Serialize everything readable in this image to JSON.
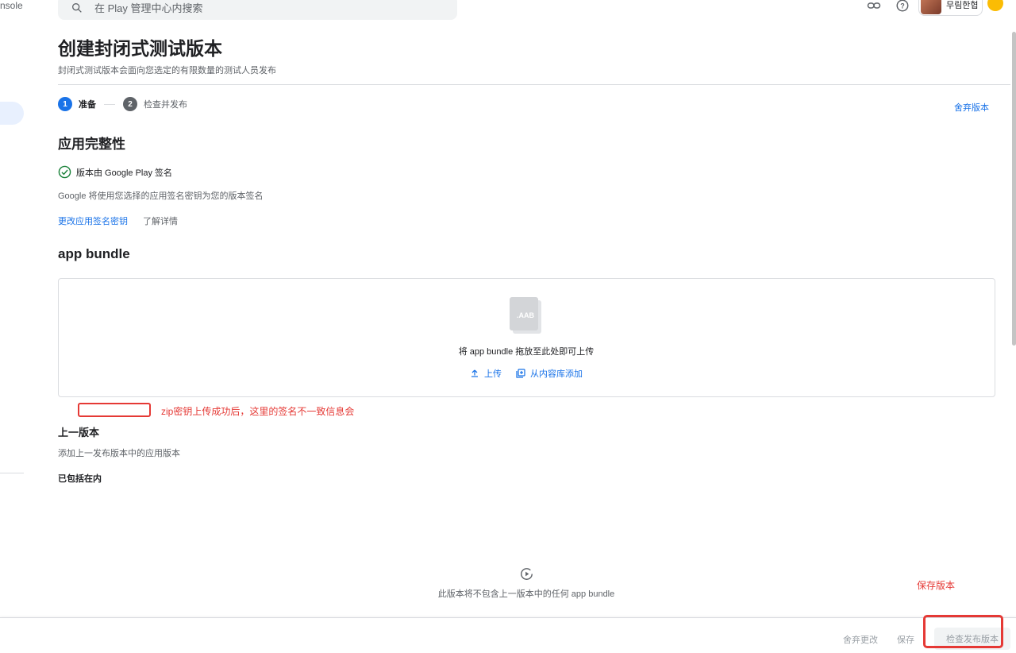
{
  "nav": {
    "console_fragment": "nsole"
  },
  "search": {
    "placeholder": "在 Play 管理中心内搜索"
  },
  "user": {
    "name": "무림한협"
  },
  "page": {
    "title": "创建封闭式测试版本",
    "subtitle": "封闭式测试版本会面向您选定的有限数量的测试人员发布"
  },
  "stepper": {
    "steps": [
      {
        "num": "1",
        "label": "准备"
      },
      {
        "num": "2",
        "label": "检查并发布"
      }
    ],
    "discard": "舍弃版本"
  },
  "integrity": {
    "title": "应用完整性",
    "status": "版本由 Google Play 签名",
    "desc": "Google 将使用您选择的应用签名密钥为您的版本签名",
    "change_link": "更改应用签名密钥",
    "learn_link": "了解详情"
  },
  "bundle": {
    "title": "app bundle",
    "file_badge": ".AAB",
    "drop_text": "将 app bundle 拖放至此处即可上传",
    "upload": "上传",
    "add_library": "从内容库添加"
  },
  "previous": {
    "title": "上一版本",
    "desc": "添加上一发布版本中的应用版本",
    "included": "已包括在内",
    "empty": "此版本将不包含上一版本中的任何 app bundle"
  },
  "annotations": {
    "note1": "zip密钥上传成功后，这里的签名不一致信息会",
    "note2": "保存版本"
  },
  "footer": {
    "discard_changes": "舍弃更改",
    "save": "保存",
    "review": "检查发布版本"
  },
  "colors": {
    "accent": "#1a73e8",
    "annotation": "#e53935",
    "success": "#188038"
  }
}
